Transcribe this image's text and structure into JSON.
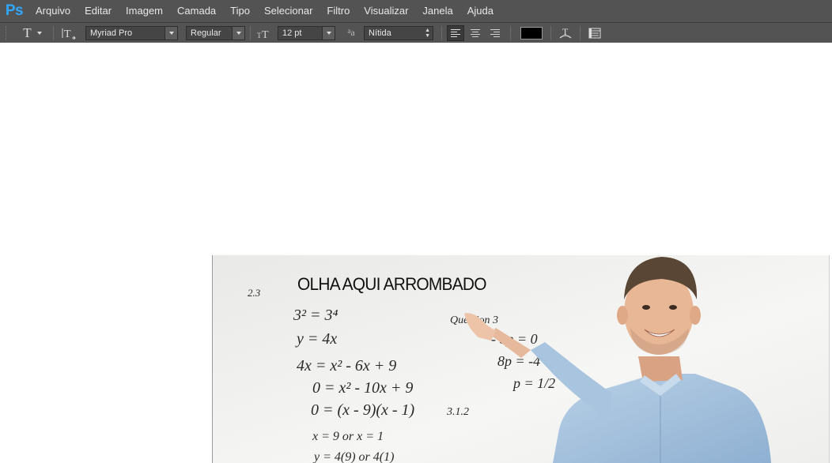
{
  "app": {
    "logo": "Ps",
    "menu": [
      "Arquivo",
      "Editar",
      "Imagem",
      "Camada",
      "Tipo",
      "Selecionar",
      "Filtro",
      "Visualizar",
      "Janela",
      "Ajuda"
    ]
  },
  "options": {
    "tool_icon": "type-tool-icon",
    "font_family": "Myriad Pro",
    "font_style": "Regular",
    "font_size": "12 pt",
    "antialias_icon": "aa-icon",
    "antialias": "Nítida",
    "text_color": "#000000"
  },
  "canvas": {
    "meme_text": "OLHA AQUI ARROMBADO",
    "board": {
      "l1": "2.3",
      "l2": "3² = 3⁴",
      "l3": "y = 4x",
      "l4": "4x = x² - 6x + 9",
      "l5": "0 = x² - 10x + 9",
      "l6": "0 = (x - 9)(x - 1)",
      "l7": "x = 9  or  x = 1",
      "l8": "y = 4(9)  or  4(1)",
      "l9": "Question 3",
      "l10": "- 8p = 0",
      "l11": "8p = -4 →",
      "l12": "p = 1/2",
      "l13": "3.1.2"
    }
  }
}
